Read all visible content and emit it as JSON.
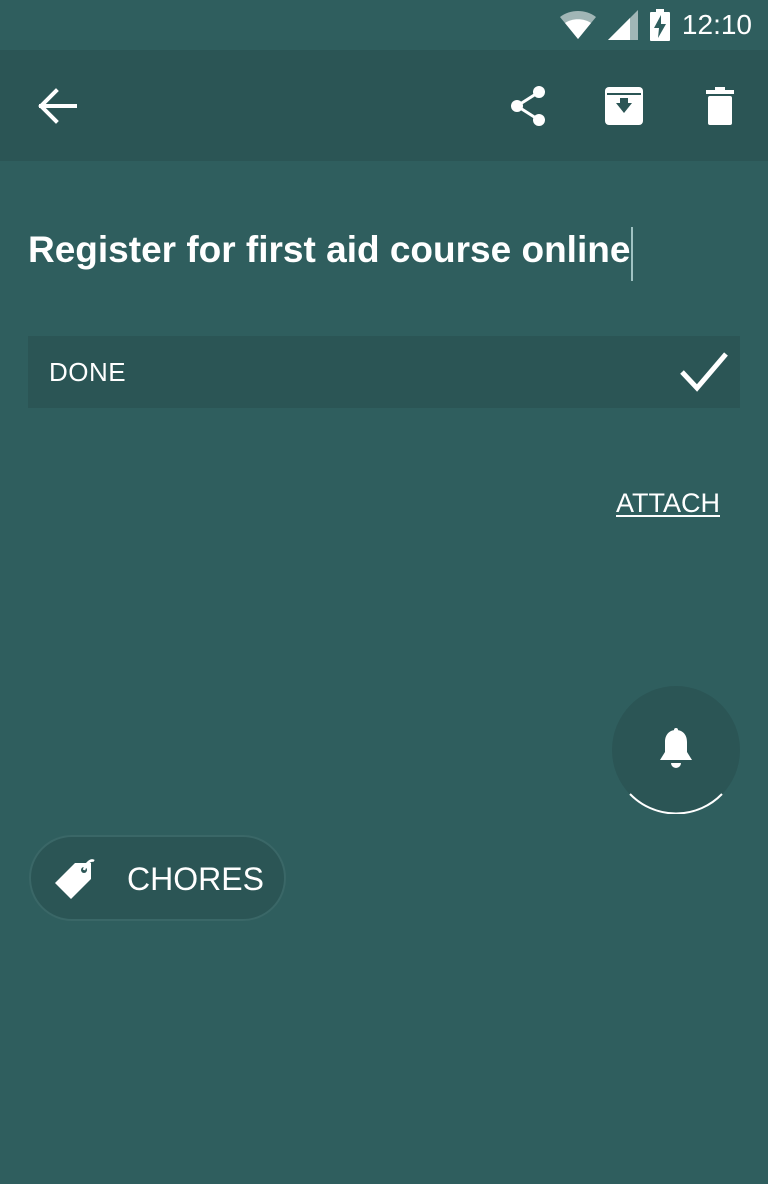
{
  "status_bar": {
    "time": "12:10",
    "icons": [
      "wifi-icon",
      "cell-signal-icon",
      "battery-charging-icon"
    ]
  },
  "toolbar": {
    "back_icon": "arrow-left-icon",
    "actions": [
      "share-icon",
      "archive-icon",
      "trash-icon"
    ]
  },
  "task": {
    "title": "Register for first aid course online",
    "done_label": "DONE",
    "done_icon": "checkmark-icon",
    "attach_label": "ATTACH"
  },
  "reminder": {
    "icon": "bell-icon"
  },
  "tag": {
    "icon": "tag-icon",
    "label": "CHORES"
  },
  "colors": {
    "background": "#2f5e5e",
    "surface": "#2b5555",
    "text": "#ffffff"
  }
}
